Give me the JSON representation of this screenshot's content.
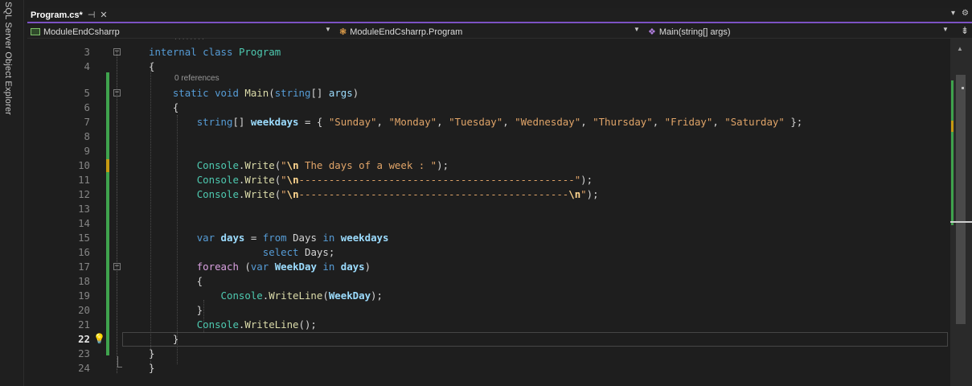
{
  "side_panel": {
    "label": "SQL Server Object Explorer"
  },
  "tab": {
    "title": "Program.cs*",
    "pin_glyph": "⊣",
    "close_glyph": "✕"
  },
  "tabbar_icons": {
    "dropdown": "▾",
    "settings": "⚙"
  },
  "navigation": {
    "project": "ModuleEndCsharrp",
    "class": "ModuleEndCsharrp.Program",
    "member": "Main(string[] args)",
    "split_glyph": "⇟"
  },
  "codelens": {
    "main": "0 references"
  },
  "lines": [
    {
      "num": "3",
      "html": "<span class=\"kw\">internal</span> <span class=\"kw\">class</span> <span class=\"type\">Program</span>"
    },
    {
      "num": "4",
      "html": "{"
    },
    {
      "num": "5",
      "html": "    <span class=\"kw\">static</span> <span class=\"kw\">void</span> <span class=\"method\">Main</span>(<span class=\"kw\">string</span>[] <span class=\"param\">args</span>)"
    },
    {
      "num": "6",
      "html": "    {"
    },
    {
      "num": "7",
      "html": "        <span class=\"kw\">string</span>[] <span class=\"var\">weekdays</span> = { <span class=\"str\">\"Sunday\"</span>, <span class=\"str\">\"Monday\"</span>, <span class=\"str\">\"Tuesday\"</span>, <span class=\"str\">\"Wednesday\"</span>, <span class=\"str\">\"Thursday\"</span>, <span class=\"str\">\"Friday\"</span>, <span class=\"str\">\"Saturday\"</span> };"
    },
    {
      "num": "8",
      "html": ""
    },
    {
      "num": "9",
      "html": ""
    },
    {
      "num": "10",
      "html": "        <span class=\"type\">Console</span>.<span class=\"method\">Write</span>(<span class=\"str\">\"</span><span class=\"esc\">\\n</span><span class=\"str\"> The days of a week : \"</span>);"
    },
    {
      "num": "11",
      "html": "        <span class=\"type\">Console</span>.<span class=\"method\">Write</span>(<span class=\"str\">\"</span><span class=\"esc\">\\n</span><span class=\"str\">----------------------------------------------\"</span>);"
    },
    {
      "num": "12",
      "html": "        <span class=\"type\">Console</span>.<span class=\"method\">Write</span>(<span class=\"str\">\"</span><span class=\"esc\">\\n</span><span class=\"str\">---------------------------------------------</span><span class=\"esc\">\\n</span><span class=\"str\">\"</span>);"
    },
    {
      "num": "13",
      "html": ""
    },
    {
      "num": "14",
      "html": ""
    },
    {
      "num": "15",
      "html": "        <span class=\"kw\">var</span> <span class=\"var\">days</span> = <span class=\"kw\">from</span> <span class=\"plain\">Days</span> <span class=\"kw\">in</span> <span class=\"var\">weekdays</span>"
    },
    {
      "num": "16",
      "html": "                   <span class=\"kw\">select</span> <span class=\"plain\">Days</span>;"
    },
    {
      "num": "17",
      "html": "        <span class=\"ctl\">foreach</span> (<span class=\"kw\">var</span> <span class=\"var\">WeekDay</span> <span class=\"kw\">in</span> <span class=\"var\">days</span>)"
    },
    {
      "num": "18",
      "html": "        {"
    },
    {
      "num": "19",
      "html": "            <span class=\"type\">Console</span>.<span class=\"method\">WriteLine</span>(<span class=\"var\">WeekDay</span>);"
    },
    {
      "num": "20",
      "html": "        }"
    },
    {
      "num": "21",
      "html": "        <span class=\"type\">Console</span>.<span class=\"method\">WriteLine</span>();"
    },
    {
      "num": "22",
      "html": "    }"
    },
    {
      "num": "23",
      "html": "}"
    },
    {
      "num": "24",
      "html": "}"
    }
  ],
  "current_line": "22",
  "colors": {
    "accent": "#7c52c4",
    "change_saved": "#3fa34d",
    "change_unsaved": "#c79a12",
    "editor_bg": "#1e1e1e"
  }
}
